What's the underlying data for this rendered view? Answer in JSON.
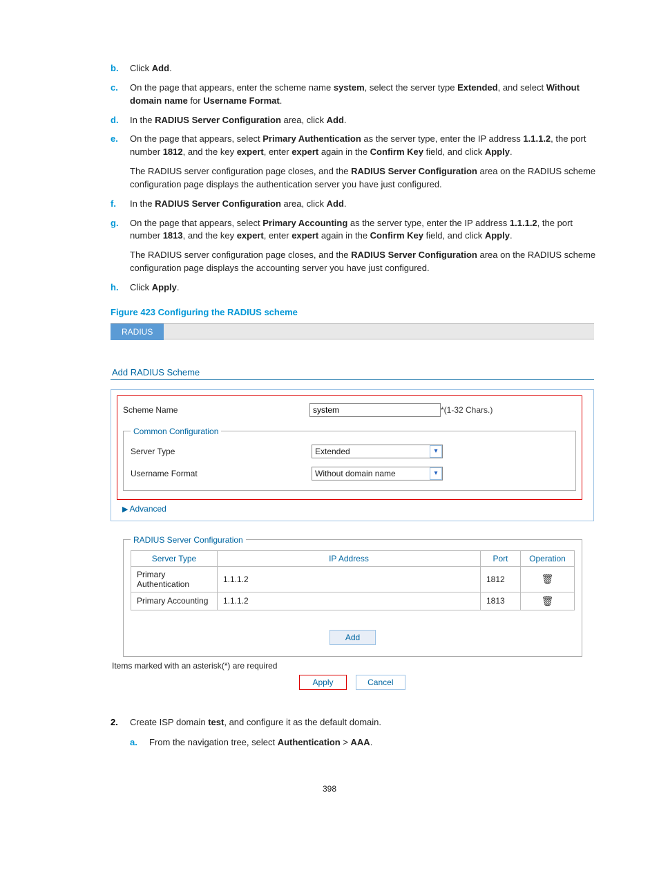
{
  "steps": {
    "b": {
      "letter": "b.",
      "prefix": "Click ",
      "bold1": "Add",
      "suffix": "."
    },
    "c": {
      "letter": "c.",
      "t1": "On the page that appears, enter the scheme name ",
      "b1": "system",
      "t2": ", select the server type ",
      "b2": "Extended",
      "t3": ", and select ",
      "b3": "Without domain name",
      "t4": " for ",
      "b4": "Username Format",
      "t5": "."
    },
    "d": {
      "letter": "d.",
      "t1": "In the ",
      "b1": "RADIUS Server Configuration",
      "t2": " area, click ",
      "b2": "Add",
      "t3": "."
    },
    "e": {
      "letter": "e.",
      "t1": "On the page that appears, select ",
      "b1": "Primary Authentication",
      "t2": " as the server type, enter the IP address ",
      "b2": "1.1.1.2",
      "t3": ", the port number ",
      "b3": "1812",
      "t4": ", and the key ",
      "b4": "expert",
      "t5": ", enter ",
      "b5": "expert",
      "t6": " again in the ",
      "b6": "Confirm Key",
      "t7": " field, and click ",
      "b7": "Apply",
      "t8": "."
    },
    "e_para": {
      "t1": "The RADIUS server configuration page closes, and the ",
      "b1": "RADIUS Server Configuration",
      "t2": " area on the RADIUS scheme configuration page displays the authentication server you have just configured."
    },
    "f": {
      "letter": "f.",
      "t1": "In the ",
      "b1": "RADIUS Server Configuration",
      "t2": " area, click ",
      "b2": "Add",
      "t3": "."
    },
    "g": {
      "letter": "g.",
      "t1": "On the page that appears, select ",
      "b1": "Primary Accounting",
      "t2": " as the server type, enter the IP address ",
      "b2": "1.1.1.2",
      "t3": ", the port number ",
      "b3": "1813",
      "t4": ", and the key ",
      "b4": "expert",
      "t5": ", enter ",
      "b5": "expert",
      "t6": " again in the ",
      "b6": "Confirm Key",
      "t7": " field, and click ",
      "b7": "Apply",
      "t8": "."
    },
    "g_para": {
      "t1": "The RADIUS server configuration page closes, and the ",
      "b1": "RADIUS Server Configuration",
      "t2": " area on the RADIUS scheme configuration page displays the accounting server you have just configured."
    },
    "h": {
      "letter": "h.",
      "prefix": "Click ",
      "bold1": "Apply",
      "suffix": "."
    }
  },
  "figure_caption": "Figure 423 Configuring the RADIUS scheme",
  "screenshot": {
    "tab_label": "RADIUS",
    "section_title": "Add RADIUS Scheme",
    "scheme_name_label": "Scheme Name",
    "scheme_name_value": "system",
    "scheme_name_hint": "*(1-32 Chars.)",
    "fieldset_common": "Common Configuration",
    "server_type_label": "Server Type",
    "server_type_value": "Extended",
    "username_format_label": "Username Format",
    "username_format_value": "Without domain name",
    "advanced": "Advanced",
    "fieldset_radius": "RADIUS Server Configuration",
    "table": {
      "headers": {
        "type": "Server Type",
        "ip": "IP Address",
        "port": "Port",
        "op": "Operation"
      },
      "rows": [
        {
          "type": "Primary Authentication",
          "ip": "1.1.1.2",
          "port": "1812"
        },
        {
          "type": "Primary Accounting",
          "ip": "1.1.1.2",
          "port": "1813"
        }
      ]
    },
    "add_btn": "Add",
    "note": "Items marked with an asterisk(*) are required",
    "apply_btn": "Apply",
    "cancel_btn": "Cancel"
  },
  "step2": {
    "num": "2.",
    "t1": "Create ISP domain ",
    "b1": "test",
    "t2": ", and configure it as the default domain."
  },
  "step2a": {
    "letter": "a.",
    "t1": "From the navigation tree, select ",
    "b1": "Authentication",
    "sep": " > ",
    "b2": "AAA",
    "t2": "."
  },
  "page_number": "398"
}
